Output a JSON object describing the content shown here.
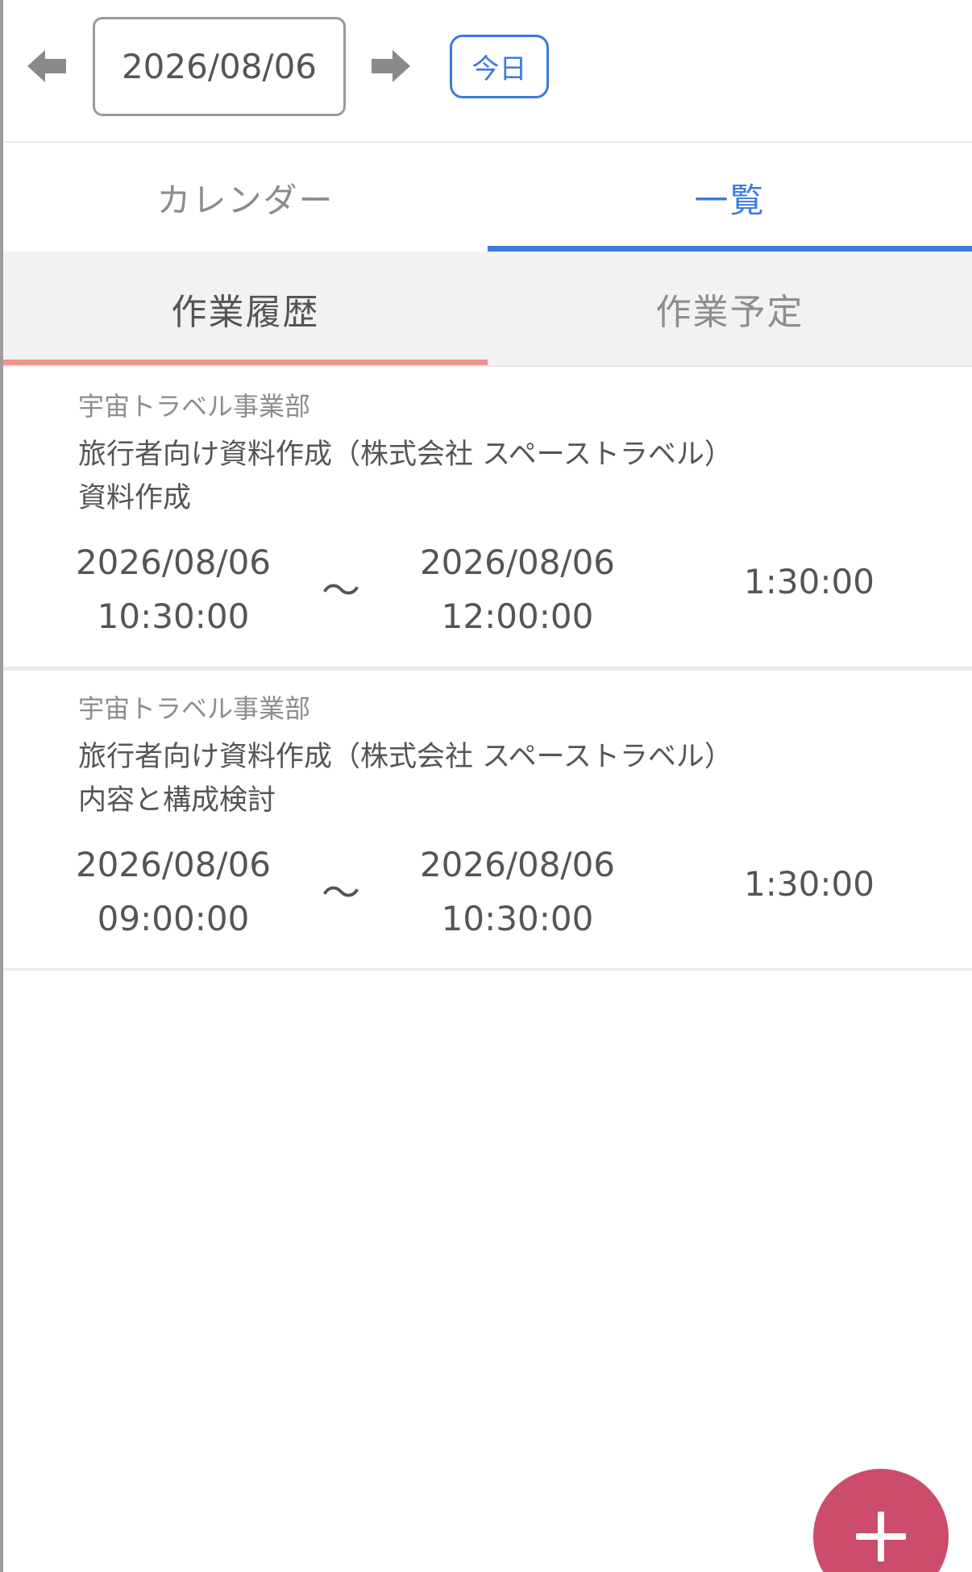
{
  "date_nav": {
    "prev_icon": "arrow-left-icon",
    "current_date": "2026/08/06",
    "next_icon": "arrow-right-icon",
    "today_label": "今日"
  },
  "main_tabs": [
    {
      "label": "カレンダー",
      "active": false
    },
    {
      "label": "一覧",
      "active": true
    }
  ],
  "sub_tabs": [
    {
      "label": "作業履歴",
      "active": true
    },
    {
      "label": "作業予定",
      "active": false
    }
  ],
  "records": [
    {
      "department": "宇宙トラベル事業部",
      "project": "旅行者向け資料作成（株式会社 スペーストラベル）",
      "task": "資料作成",
      "start_date": "2026/08/06",
      "start_time": "10:30:00",
      "separator": "〜",
      "end_date": "2026/08/06",
      "end_time": "12:00:00",
      "duration": "1:30:00"
    },
    {
      "department": "宇宙トラベル事業部",
      "project": "旅行者向け資料作成（株式会社 スペーストラベル）",
      "task": "内容と構成検討",
      "start_date": "2026/08/06",
      "start_time": "09:00:00",
      "separator": "〜",
      "end_date": "2026/08/06",
      "end_time": "10:30:00",
      "duration": "1:30:00"
    }
  ],
  "fab": {
    "icon": "plus-icon"
  },
  "colors": {
    "accent_blue": "#3a7bdd",
    "subtab_indicator": "#f0928d",
    "fab": "#cc4d6b"
  }
}
